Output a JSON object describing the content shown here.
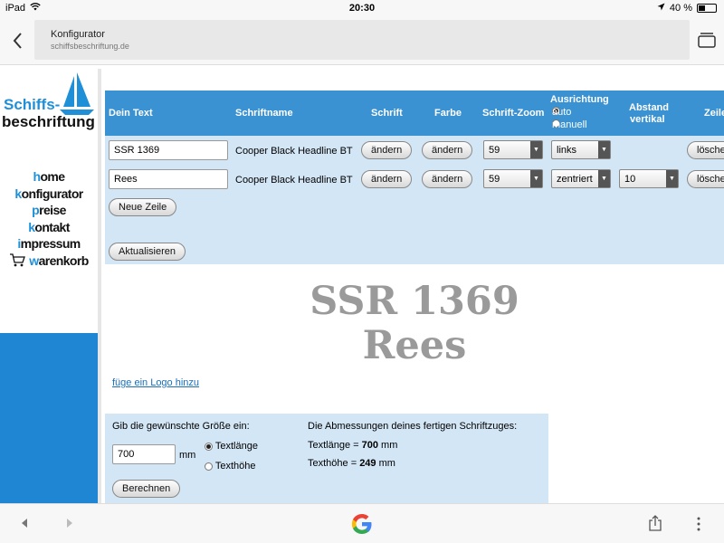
{
  "status_bar": {
    "device": "iPad",
    "time": "20:30",
    "battery": "40 %",
    "battery_level": 0.4
  },
  "browser": {
    "page_title": "Konfigurator",
    "url": "schiffsbeschriftung.de"
  },
  "logo": {
    "line1": "Schiffs-",
    "line2": "beschriftung"
  },
  "nav": [
    {
      "first": "h",
      "rest": "ome"
    },
    {
      "first": "k",
      "rest": "onfigurator"
    },
    {
      "first": "p",
      "rest": "reise"
    },
    {
      "first": "k",
      "rest": "ontakt"
    },
    {
      "first": "i",
      "rest": "mpressum"
    },
    {
      "first": "w",
      "rest": "arenkorb"
    }
  ],
  "table": {
    "headers": {
      "text": "Dein Text",
      "font_name": "Schriftname",
      "font": "Schrift",
      "color": "Farbe",
      "zoom": "Schrift-Zoom",
      "alignment": "Ausrichtung",
      "align_auto": "auto",
      "align_manual": "manuell",
      "spacing_line1": "Abstand",
      "spacing_line2": "vertikal",
      "line": "Zeile"
    },
    "rows": [
      {
        "text": "SSR 1369",
        "font_name": "Cooper Black Headline BT",
        "font_btn": "ändern",
        "color_btn": "ändern",
        "zoom": "59",
        "alignment": "links",
        "spacing": "",
        "delete": "lösche"
      },
      {
        "text": "Rees",
        "font_name": "Cooper Black Headline BT",
        "font_btn": "ändern",
        "color_btn": "ändern",
        "zoom": "59",
        "alignment": "zentriert",
        "spacing": "10",
        "delete": "lösche"
      }
    ],
    "new_line_btn": "Neue Zeile",
    "update_btn": "Aktualisieren"
  },
  "preview": {
    "line1": "SSR 1369",
    "line2": "Rees",
    "add_logo": "füge ein Logo hinzu"
  },
  "calculator": {
    "prompt": "Gib die gewünschte Größe ein:",
    "size_value": "700",
    "unit": "mm",
    "option_length": "Textlänge",
    "option_height": "Texthöhe",
    "selected": "Textlänge",
    "calc_btn": "Berechnen",
    "result_intro": "Die Abmessungen deines fertigen Schriftzuges:",
    "length_label": "Textlänge = ",
    "length_value": "700",
    "height_label": "Texthöhe = ",
    "height_value": "249",
    "result_unit": " mm"
  },
  "colors": {
    "header_blue": "#3a92d2",
    "panel_blue": "#d3e6f6",
    "sidebar_blue": "#1e86d2",
    "preview_gray": "#9a9a9a"
  }
}
